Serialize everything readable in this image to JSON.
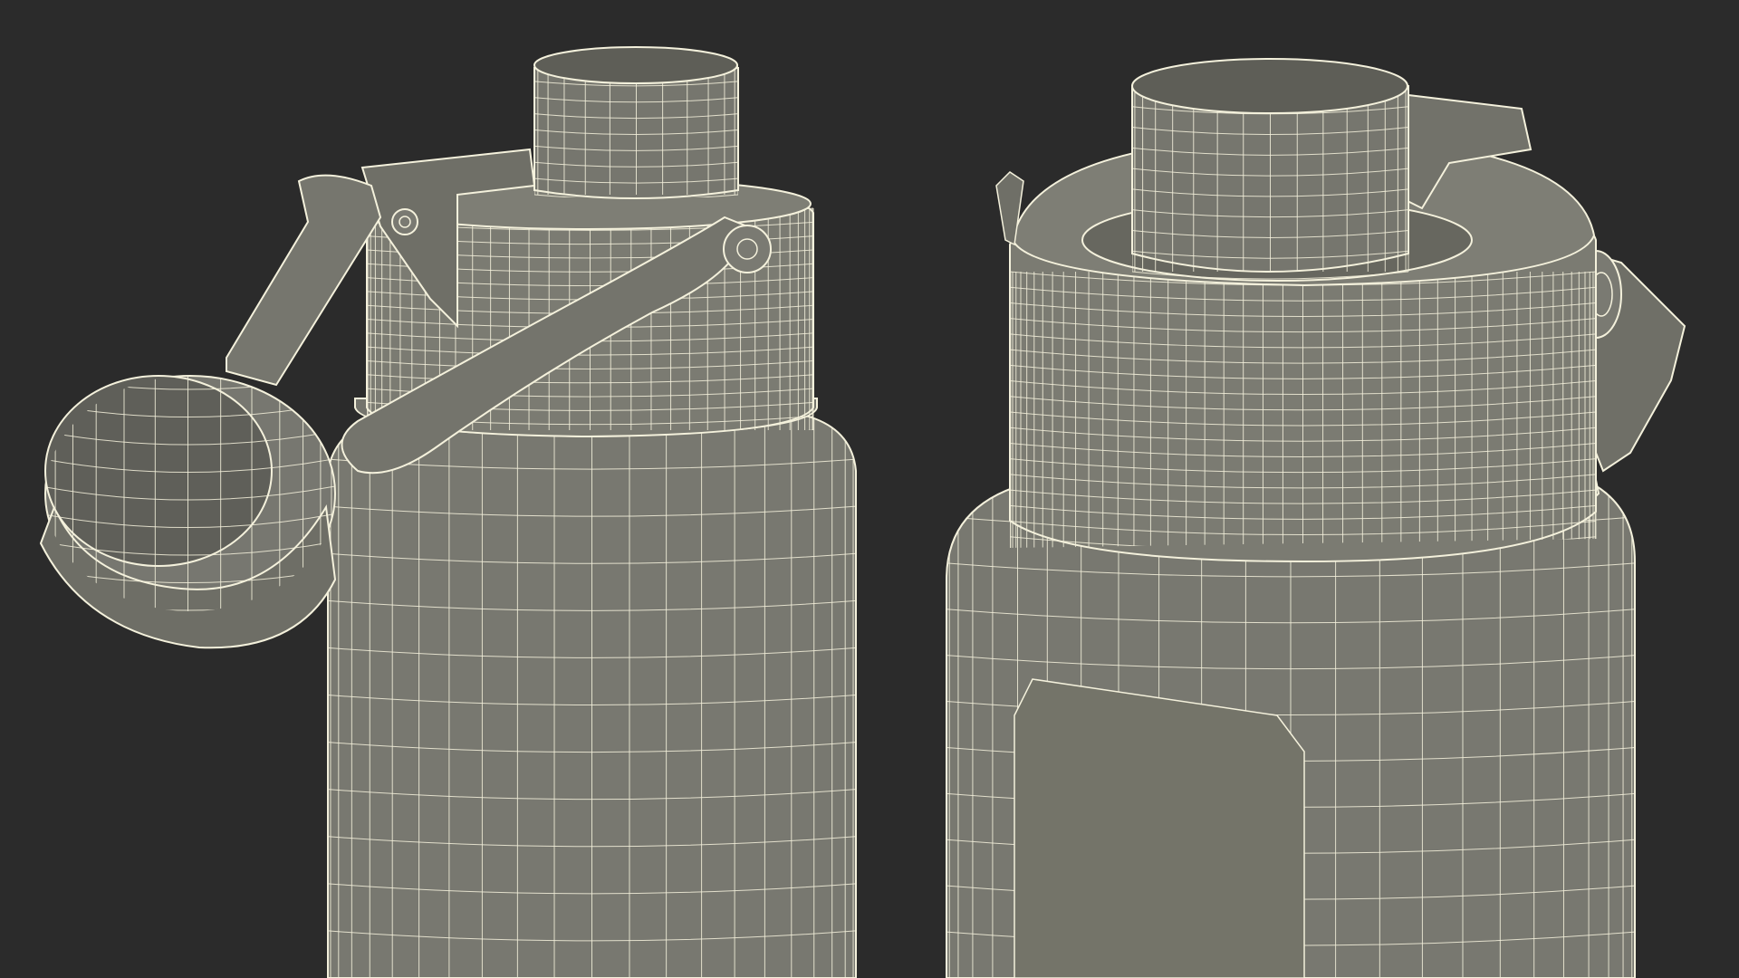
{
  "scene": {
    "background": "#2b2b2b",
    "surface": "#7a7a70",
    "surface_dark": "#6b6b62",
    "surface_shadow": "#5c5c55",
    "wire": "#f4f1dc",
    "objects": [
      {
        "name": "bottle-left",
        "state": "lid-open"
      },
      {
        "name": "bottle-right",
        "state": "lid-closed"
      }
    ]
  }
}
